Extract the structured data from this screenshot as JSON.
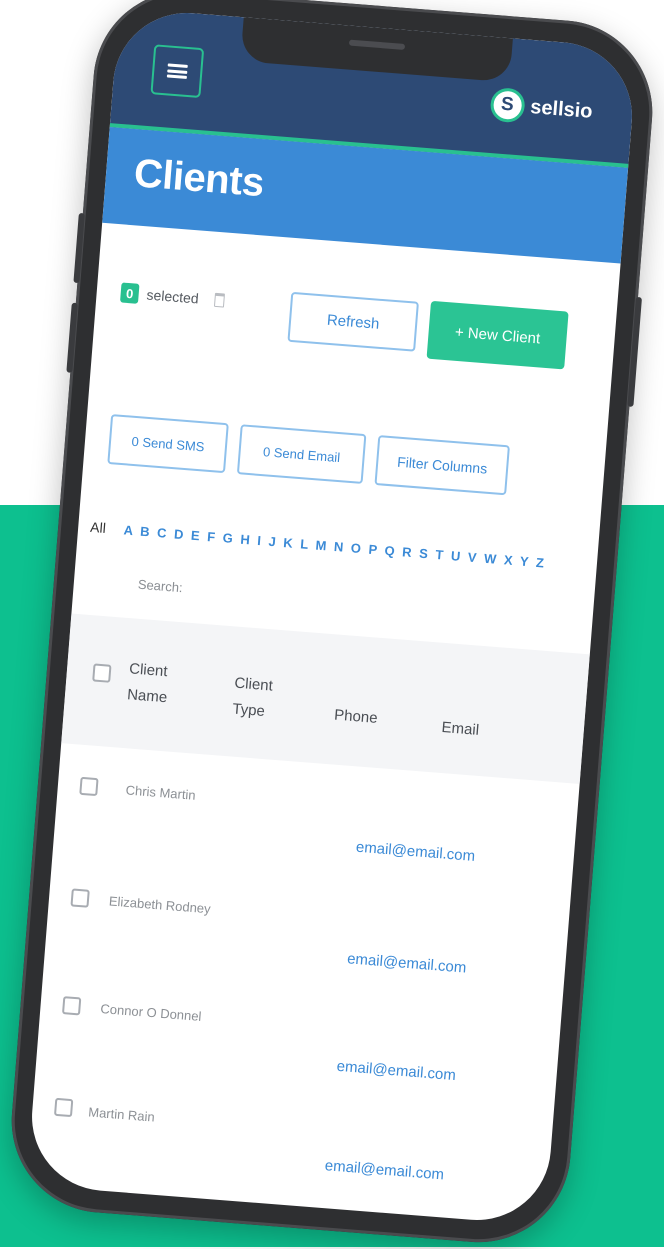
{
  "header": {
    "brand_logo": "S",
    "brand_name": "sellsio",
    "title": "Clients"
  },
  "toolbar": {
    "selected_count": "0",
    "selected_label": "selected",
    "refresh_label": "Refresh",
    "new_client_label": "+ New Client",
    "send_sms_label": "0 Send SMS",
    "send_email_label": "0 Send Email",
    "filter_columns_label": "Filter Columns"
  },
  "alphabet": {
    "all_label": "All",
    "letters": "A B C D E F G H I J K L M N O P Q R S T U V W X Y Z"
  },
  "search": {
    "label": "Search:"
  },
  "table": {
    "columns": [
      "Client Name",
      "Client Type",
      "Phone",
      "Email"
    ],
    "rows": [
      {
        "name": "Chris Martin",
        "email": "email@email.com"
      },
      {
        "name": "Elizabeth Rodney",
        "email": "email@email.com"
      },
      {
        "name": "Connor O Donnel",
        "email": "email@email.com"
      },
      {
        "name": "Martin Rain",
        "email": "email@email.com"
      }
    ]
  },
  "colors": {
    "background_green": "#0dc08f",
    "topbar": "#2d4a75",
    "title_blue": "#3b8ad6",
    "accent_green": "#29c090"
  }
}
